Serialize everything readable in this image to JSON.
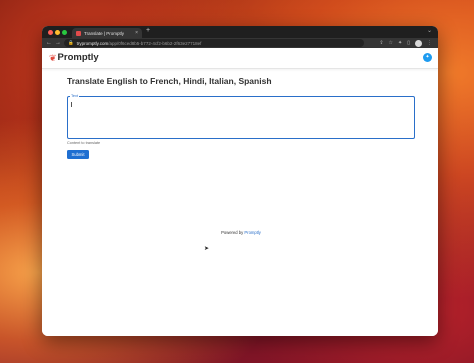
{
  "browser": {
    "tab_title": "Translate | Promptly",
    "tab_close": "×",
    "new_tab": "+",
    "url_host": "trypromptly.com",
    "url_path": "/app/0f6ced8b5-b772-4cf2-b6b2-2f63e27718ef",
    "icons": [
      "share-icon",
      "star-icon",
      "extensions-icon",
      "sidebar-icon",
      "profile-icon",
      "menu-icon"
    ]
  },
  "header": {
    "logo_text": "Promptly",
    "social": "twitter-icon"
  },
  "app": {
    "title": "Translate English to French, Hindi, Italian, Spanish",
    "input_label": "Text",
    "input_value": "",
    "helper_text": "Content to translate",
    "submit_label": "Submit"
  },
  "footer": {
    "powered_prefix": "Powered by",
    "powered_link": "Promptly"
  },
  "colors": {
    "accent": "#1f6fd1",
    "brand": "#e0473c",
    "twitter": "#1d9bf0"
  }
}
